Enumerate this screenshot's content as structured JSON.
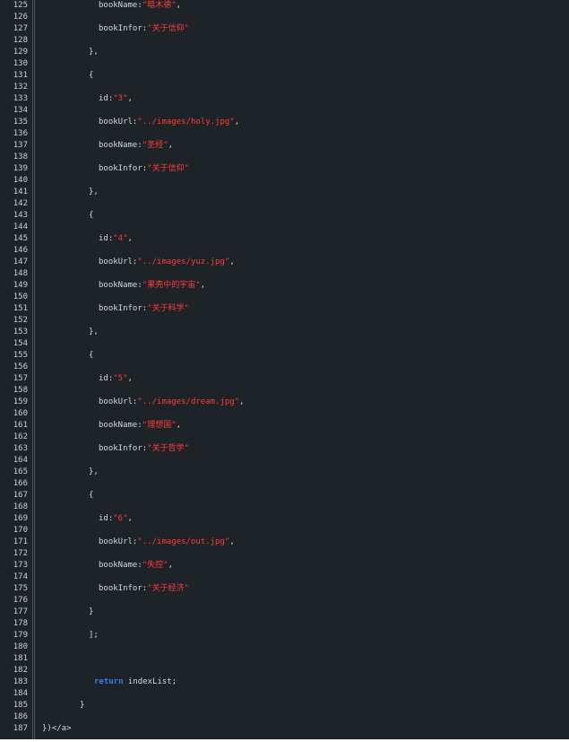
{
  "colors": {
    "background": "#1e2327",
    "text": "#d4d8dc",
    "line_number": "#c9cfd4",
    "string": "#ff3b3b",
    "keyword": "#2f7fe8"
  },
  "lines": [
    {
      "n": "125",
      "indent": 6,
      "t": [
        {
          "c": "bookName:"
        },
        {
          "c": "\"暗木德\"",
          "s": "str"
        },
        {
          "c": ","
        }
      ]
    },
    {
      "n": "126",
      "indent": 0,
      "t": []
    },
    {
      "n": "127",
      "indent": 6,
      "t": [
        {
          "c": "bookInfor:"
        },
        {
          "c": "\"关于信仰\"",
          "s": "str"
        }
      ]
    },
    {
      "n": "128",
      "indent": 0,
      "t": []
    },
    {
      "n": "129",
      "indent": 5,
      "t": [
        {
          "c": "},"
        }
      ]
    },
    {
      "n": "130",
      "indent": 0,
      "t": []
    },
    {
      "n": "131",
      "indent": 5,
      "t": [
        {
          "c": "{"
        }
      ]
    },
    {
      "n": "132",
      "indent": 0,
      "t": []
    },
    {
      "n": "133",
      "indent": 6,
      "t": [
        {
          "c": "id:"
        },
        {
          "c": "\"3\"",
          "s": "str"
        },
        {
          "c": ","
        }
      ]
    },
    {
      "n": "134",
      "indent": 0,
      "t": []
    },
    {
      "n": "135",
      "indent": 6,
      "t": [
        {
          "c": "bookUrl:"
        },
        {
          "c": "\"../images/holy.jpg\"",
          "s": "str"
        },
        {
          "c": ","
        }
      ]
    },
    {
      "n": "136",
      "indent": 0,
      "t": []
    },
    {
      "n": "137",
      "indent": 6,
      "t": [
        {
          "c": "bookName:"
        },
        {
          "c": "\"圣经\"",
          "s": "str"
        },
        {
          "c": ","
        }
      ]
    },
    {
      "n": "138",
      "indent": 0,
      "t": []
    },
    {
      "n": "139",
      "indent": 6,
      "t": [
        {
          "c": "bookInfor:"
        },
        {
          "c": "\"关于信仰\"",
          "s": "str"
        }
      ]
    },
    {
      "n": "140",
      "indent": 0,
      "t": []
    },
    {
      "n": "141",
      "indent": 5,
      "t": [
        {
          "c": "},"
        }
      ]
    },
    {
      "n": "142",
      "indent": 0,
      "t": []
    },
    {
      "n": "143",
      "indent": 5,
      "t": [
        {
          "c": "{"
        }
      ]
    },
    {
      "n": "144",
      "indent": 0,
      "t": []
    },
    {
      "n": "145",
      "indent": 6,
      "t": [
        {
          "c": "id:"
        },
        {
          "c": "\"4\"",
          "s": "str"
        },
        {
          "c": ","
        }
      ]
    },
    {
      "n": "146",
      "indent": 0,
      "t": []
    },
    {
      "n": "147",
      "indent": 6,
      "t": [
        {
          "c": "bookUrl:"
        },
        {
          "c": "\"../images/yuz.jpg\"",
          "s": "str"
        },
        {
          "c": ","
        }
      ]
    },
    {
      "n": "148",
      "indent": 0,
      "t": []
    },
    {
      "n": "149",
      "indent": 6,
      "t": [
        {
          "c": "bookName:"
        },
        {
          "c": "\"果壳中的宇宙\"",
          "s": "str"
        },
        {
          "c": ","
        }
      ]
    },
    {
      "n": "150",
      "indent": 0,
      "t": []
    },
    {
      "n": "151",
      "indent": 6,
      "t": [
        {
          "c": "bookInfor:"
        },
        {
          "c": "\"关于科学\"",
          "s": "str"
        }
      ]
    },
    {
      "n": "152",
      "indent": 0,
      "t": []
    },
    {
      "n": "153",
      "indent": 5,
      "t": [
        {
          "c": "},"
        }
      ]
    },
    {
      "n": "154",
      "indent": 0,
      "t": []
    },
    {
      "n": "155",
      "indent": 5,
      "t": [
        {
          "c": "{"
        }
      ]
    },
    {
      "n": "156",
      "indent": 0,
      "t": []
    },
    {
      "n": "157",
      "indent": 6,
      "t": [
        {
          "c": "id:"
        },
        {
          "c": "\"5\"",
          "s": "str"
        },
        {
          "c": ","
        }
      ]
    },
    {
      "n": "158",
      "indent": 0,
      "t": []
    },
    {
      "n": "159",
      "indent": 6,
      "t": [
        {
          "c": "bookUrl:"
        },
        {
          "c": "\"../images/dream.jpg\"",
          "s": "str"
        },
        {
          "c": ","
        }
      ]
    },
    {
      "n": "160",
      "indent": 0,
      "t": []
    },
    {
      "n": "161",
      "indent": 6,
      "t": [
        {
          "c": "bookName:"
        },
        {
          "c": "\"理想国\"",
          "s": "str"
        },
        {
          "c": ","
        }
      ]
    },
    {
      "n": "162",
      "indent": 0,
      "t": []
    },
    {
      "n": "163",
      "indent": 6,
      "t": [
        {
          "c": "bookInfor:"
        },
        {
          "c": "\"关于哲学\"",
          "s": "str"
        }
      ]
    },
    {
      "n": "164",
      "indent": 0,
      "t": []
    },
    {
      "n": "165",
      "indent": 5,
      "t": [
        {
          "c": "},"
        }
      ]
    },
    {
      "n": "166",
      "indent": 0,
      "t": []
    },
    {
      "n": "167",
      "indent": 5,
      "t": [
        {
          "c": "{"
        }
      ]
    },
    {
      "n": "168",
      "indent": 0,
      "t": []
    },
    {
      "n": "169",
      "indent": 6,
      "t": [
        {
          "c": "id:"
        },
        {
          "c": "\"6\"",
          "s": "str"
        },
        {
          "c": ","
        }
      ]
    },
    {
      "n": "170",
      "indent": 0,
      "t": []
    },
    {
      "n": "171",
      "indent": 6,
      "t": [
        {
          "c": "bookUrl:"
        },
        {
          "c": "\"../images/out.jpg\"",
          "s": "str"
        },
        {
          "c": ","
        }
      ]
    },
    {
      "n": "172",
      "indent": 0,
      "t": []
    },
    {
      "n": "173",
      "indent": 6,
      "t": [
        {
          "c": "bookName:"
        },
        {
          "c": "\"失控\"",
          "s": "str"
        },
        {
          "c": ","
        }
      ]
    },
    {
      "n": "174",
      "indent": 0,
      "t": []
    },
    {
      "n": "175",
      "indent": 6,
      "t": [
        {
          "c": "bookInfor:"
        },
        {
          "c": "\"关于经济\"",
          "s": "str"
        }
      ]
    },
    {
      "n": "176",
      "indent": 0,
      "t": []
    },
    {
      "n": "177",
      "indent": 5,
      "t": [
        {
          "c": "}"
        }
      ]
    },
    {
      "n": "178",
      "indent": 0,
      "t": []
    },
    {
      "n": "179",
      "indent": 5,
      "t": [
        {
          "c": "];"
        }
      ]
    },
    {
      "n": "180",
      "indent": 0,
      "t": []
    },
    {
      "n": "181",
      "indent": 0,
      "t": []
    },
    {
      "n": "182",
      "indent": 0,
      "t": []
    },
    {
      "n": "183",
      "indent": 4,
      "t": [
        {
          "c": "return",
          "s": "kw"
        },
        {
          "c": " indexList;"
        }
      ]
    },
    {
      "n": "184",
      "indent": 0,
      "t": []
    },
    {
      "n": "185",
      "indent": 3,
      "t": [
        {
          "c": "}"
        }
      ]
    },
    {
      "n": "186",
      "indent": 0,
      "t": []
    },
    {
      "n": "187",
      "indent": 0,
      "t": [
        {
          "c": "})</a>"
        }
      ]
    }
  ]
}
